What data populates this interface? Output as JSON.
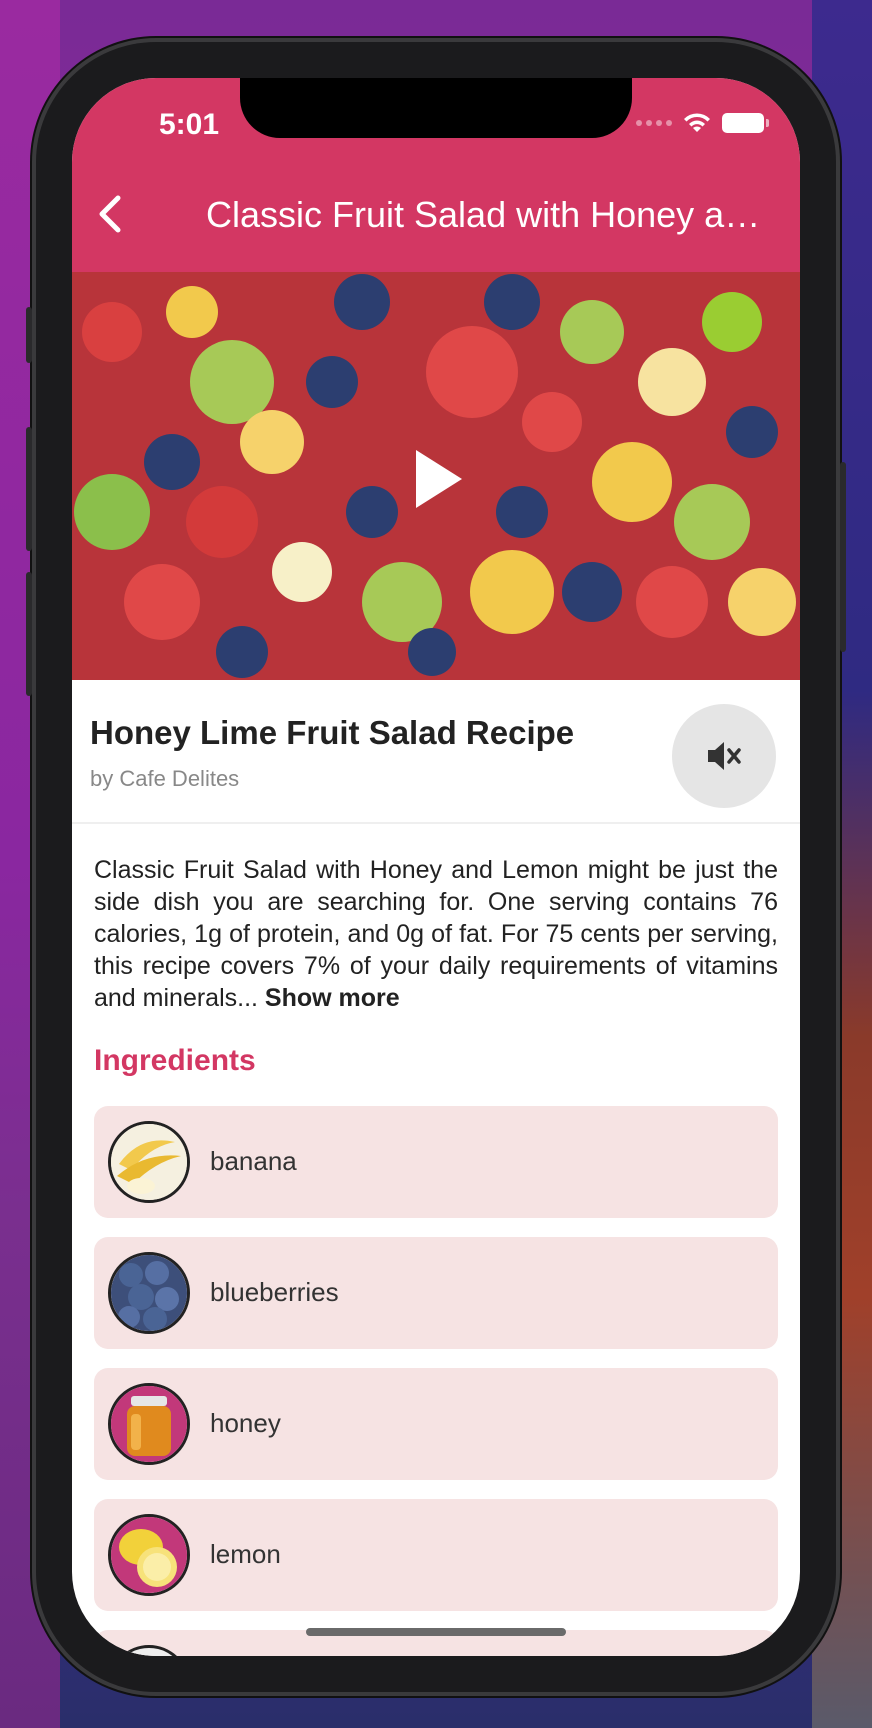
{
  "status_bar": {
    "time": "5:01"
  },
  "app_bar": {
    "title": "Classic Fruit Salad with Honey and Lemon",
    "back_icon": "chevron-left-icon"
  },
  "video": {
    "play_icon": "play-icon",
    "progress_fraction": 0.08
  },
  "recipe": {
    "title": "Honey Lime Fruit Salad Recipe",
    "byline": "by Cafe Delites",
    "mute_icon": "volume-off-icon"
  },
  "description": {
    "text": "Classic Fruit Salad with Honey and Lemon might be just the side dish you are searching for. One serving contains 76 calories, 1g of protein, and 0g of fat. For 75 cents per serving, this recipe covers 7% of your daily requirements of vitamins and minerals...",
    "show_more": "Show more"
  },
  "ingredients": {
    "heading": "Ingredients",
    "items": [
      {
        "name": "banana"
      },
      {
        "name": "blueberries"
      },
      {
        "name": "honey"
      },
      {
        "name": "lemon"
      }
    ]
  },
  "colors": {
    "accent": "#d33763",
    "ingredient_bg": "#f6e3e3"
  }
}
